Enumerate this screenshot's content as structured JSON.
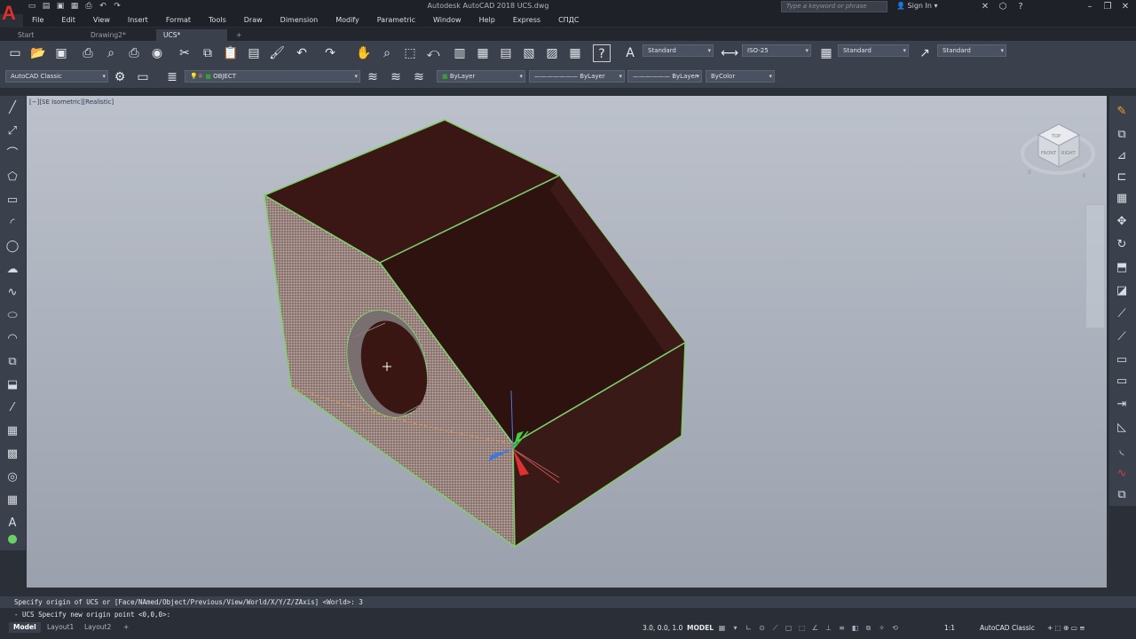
{
  "app": {
    "logo": "A",
    "window_title": "Autodesk AutoCAD 2018    UCS.dwg",
    "search_placeholder": "Type a keyword or phrase",
    "signin": "Sign In"
  },
  "menu": [
    "File",
    "Edit",
    "View",
    "Insert",
    "Format",
    "Tools",
    "Draw",
    "Dimension",
    "Modify",
    "Parametric",
    "Window",
    "Help",
    "Express",
    "СПДС"
  ],
  "tabs": {
    "start": "Start",
    "drawing2": "Drawing2*",
    "ucs": "UCS*",
    "add": "+"
  },
  "toolbar": {
    "text_style": "Standard",
    "dim_style": "ISO-25",
    "table_style": "Standard",
    "multileader_style": "Standard",
    "workspace": "AutoCAD Classic",
    "layer": "OBJECT",
    "color": "ByLayer",
    "linetype": "ByLayer",
    "lineweight": "ByLayer",
    "plotstyle": "ByColor"
  },
  "viewport": {
    "label": "[−][SE Isometric][Realistic]",
    "viewcube": {
      "top": "TOP",
      "front": "FRONT",
      "right": "RIGHT",
      "s": "S",
      "e": "E"
    }
  },
  "command": {
    "history": "Specify origin of UCS or [Face/NAmed/Object/Previous/View/World/X/Y/Z/ZAxis] <World>: 3",
    "prompt": "- UCS Specify new origin point <0,0,0>:"
  },
  "layout_tabs": [
    "Model",
    "Layout1",
    "Layout2"
  ],
  "status": {
    "coords": "3.0, 0.0, 1.0",
    "space": "MODEL",
    "scale": "1:1",
    "workspace": "AutoCAD Classic"
  },
  "colors": {
    "accent_red": "#d9322e",
    "model_face": "#3a1715",
    "edge_green": "#7fcf6a"
  }
}
